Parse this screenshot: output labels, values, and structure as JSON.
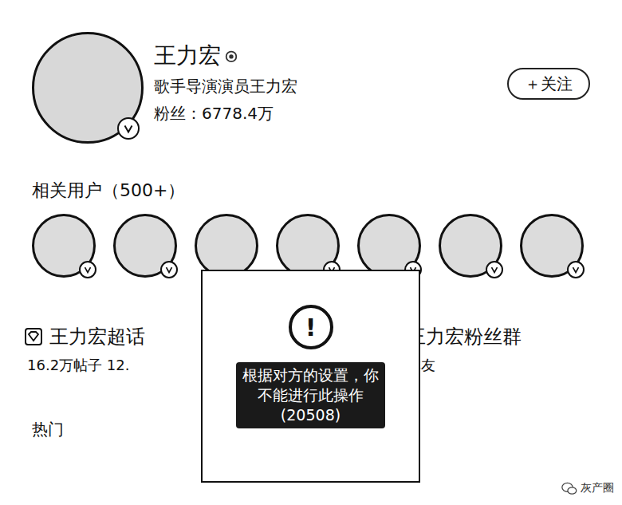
{
  "profile": {
    "name": "王力宏",
    "bio": "歌手导演演员王力宏",
    "fans": "粉丝：6778.4万",
    "verified": true
  },
  "follow_button": {
    "label": "＋关注"
  },
  "related": {
    "title": "相关用户（500+）",
    "users": [
      {
        "verified": true
      },
      {
        "verified": true
      },
      {
        "verified": false
      },
      {
        "verified": true
      },
      {
        "verified": true
      },
      {
        "verified": true
      },
      {
        "verified": true
      }
    ]
  },
  "topics": [
    {
      "title": "王力宏超话",
      "subtitle": "16.2万帖子 12.",
      "icon": true
    },
    {
      "title": "王力宏粉丝群",
      "subtitle": "群友",
      "icon": false
    }
  ],
  "section": "热门",
  "toast": {
    "icon": "!",
    "lines": [
      "根据对方的设置，你",
      "不能进行此操作",
      "(20508)"
    ]
  },
  "watermark": "灰产圈"
}
